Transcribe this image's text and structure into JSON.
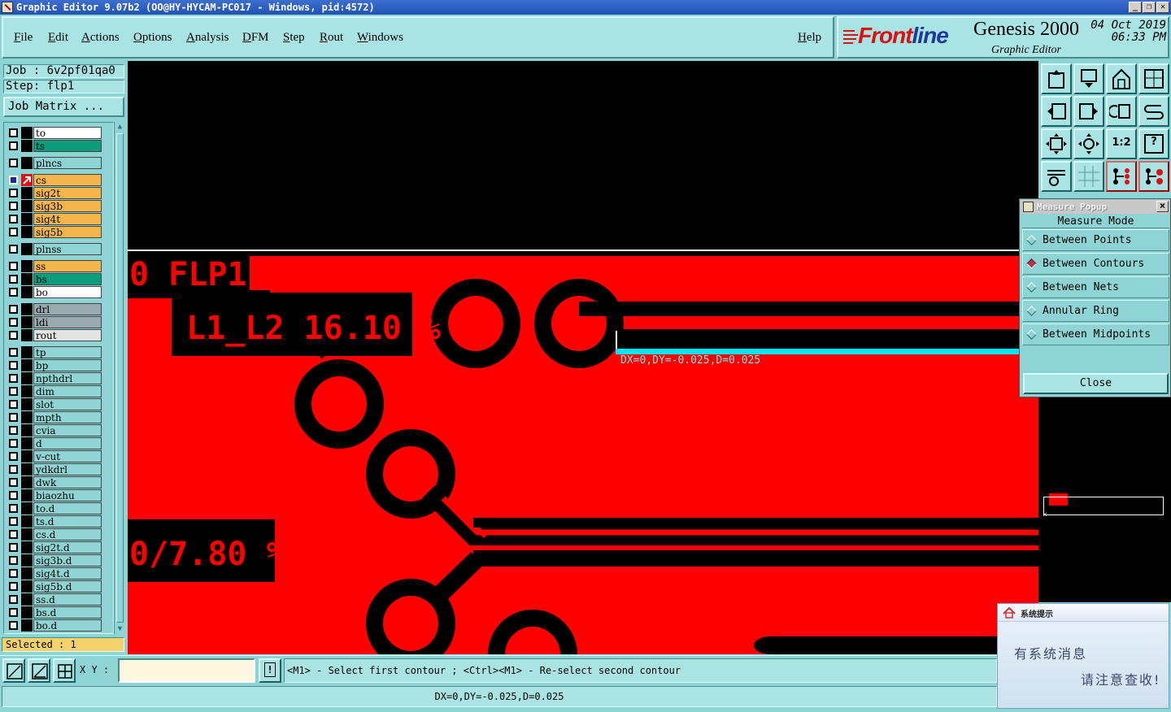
{
  "window": {
    "title": "Graphic Editor 9.07b2 (OO@HY-HYCAM-PC017 - Windows, pid:4572)",
    "minimize": "_",
    "restore": "❐",
    "close": "✕"
  },
  "menu": {
    "items": [
      "File",
      "Edit",
      "Actions",
      "Options",
      "Analysis",
      "DFM",
      "Step",
      "Rout",
      "Windows"
    ],
    "help": "Help"
  },
  "brand": {
    "logo_prefix": "Front",
    "logo_suffix": "line",
    "product": "Genesis 2000",
    "subtitle": "Graphic Editor",
    "date": "04 Oct 2019",
    "time": "06:33 PM"
  },
  "job": {
    "job_line": "Job : 6v2pf01qa0",
    "step_line": "Step: flp1",
    "matrix_button": "Job Matrix ..."
  },
  "layers": [
    {
      "name": "to",
      "color": "#ffffff"
    },
    {
      "name": "ts",
      "color": "#0c9e7c"
    },
    {
      "name": "plncs",
      "color": "#8fd4d4"
    },
    {
      "name": "cs",
      "color": "#f4b64a",
      "active": true
    },
    {
      "name": "sig2t",
      "color": "#f4b64a"
    },
    {
      "name": "sig3b",
      "color": "#f4b64a"
    },
    {
      "name": "sig4t",
      "color": "#f4b64a"
    },
    {
      "name": "sig5b",
      "color": "#f4b64a"
    },
    {
      "name": "plnss",
      "color": "#8fd4d4"
    },
    {
      "name": "ss",
      "color": "#f4b64a"
    },
    {
      "name": "bs",
      "color": "#0c9e7c"
    },
    {
      "name": "bo",
      "color": "#ffffff"
    },
    {
      "name": "drl",
      "color": "#9aa8b0"
    },
    {
      "name": "ldi",
      "color": "#9aa8b0"
    },
    {
      "name": "rout",
      "color": "#e4e4e4"
    },
    {
      "name": "tp",
      "color": "#8fd4d4"
    },
    {
      "name": "bp",
      "color": "#8fd4d4"
    },
    {
      "name": "npthdrl",
      "color": "#8fd4d4"
    },
    {
      "name": "dim",
      "color": "#8fd4d4"
    },
    {
      "name": "slot",
      "color": "#8fd4d4"
    },
    {
      "name": "mpth",
      "color": "#8fd4d4"
    },
    {
      "name": "cvia",
      "color": "#8fd4d4"
    },
    {
      "name": "d",
      "color": "#8fd4d4"
    },
    {
      "name": "v-cut",
      "color": "#8fd4d4"
    },
    {
      "name": "ydkdrl",
      "color": "#8fd4d4"
    },
    {
      "name": "dwk",
      "color": "#8fd4d4"
    },
    {
      "name": "biaozhu",
      "color": "#8fd4d4"
    },
    {
      "name": "to.d",
      "color": "#8fd4d4"
    },
    {
      "name": "ts.d",
      "color": "#8fd4d4"
    },
    {
      "name": "cs.d",
      "color": "#8fd4d4"
    },
    {
      "name": "sig2t.d",
      "color": "#8fd4d4"
    },
    {
      "name": "sig3b.d",
      "color": "#8fd4d4"
    },
    {
      "name": "sig4t.d",
      "color": "#8fd4d4"
    },
    {
      "name": "sig5b.d",
      "color": "#8fd4d4"
    },
    {
      "name": "ss.d",
      "color": "#8fd4d4"
    },
    {
      "name": "bs.d",
      "color": "#8fd4d4"
    },
    {
      "name": "bo.d",
      "color": "#8fd4d4"
    }
  ],
  "selected_text": "Selected : 1",
  "canvas": {
    "label_flp": "0 FLP1",
    "label_l1l2": "L1_L2 16.10 %",
    "label_780": "0/7.80 %",
    "measure_readout": "DX=0,DY=-0.025,D=0.025",
    "layer_color": "#ff0000",
    "measure_color": "#00e5ff"
  },
  "measure_popup": {
    "title": "Measure Popup",
    "mode_label": "Measure Mode",
    "options": [
      "Between Points",
      "Between Contours",
      "Between Nets",
      "Annular Ring",
      "Between Midpoints"
    ],
    "selected_option": "Between Contours",
    "close_label": "Close"
  },
  "toolbar": {
    "zoom_ratio_label": "1:2",
    "help_label": "?"
  },
  "bottom": {
    "xy_label": "X Y :",
    "xy_value": "",
    "exclaim": "!",
    "prompt": "<M1> - Select first contour ; <Ctrl><M1> - Re-select second contour",
    "status": "DX=0,DY=-0.025,D=0.025"
  },
  "notification": {
    "title": "系统提示",
    "line1": "有系统消息",
    "line2": "请注意查收!"
  }
}
